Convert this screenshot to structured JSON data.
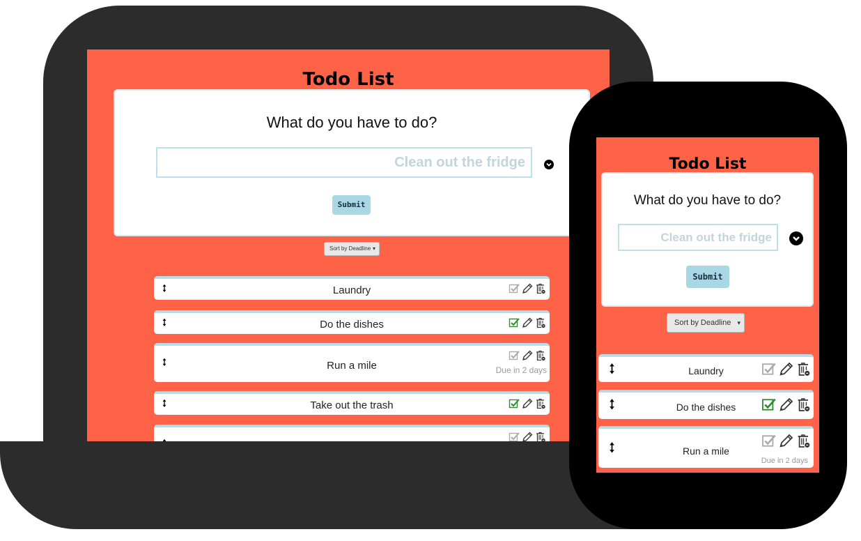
{
  "app": {
    "title": "Todo List",
    "question": "What do you have to do?",
    "input_placeholder": "Clean out the fridge",
    "submit_label": "Submit",
    "sort_label": "Sort by Deadline",
    "sort_arrow": "▾"
  },
  "todos": [
    {
      "label": "Laundry",
      "done": false,
      "due": ""
    },
    {
      "label": "Do the dishes",
      "done": true,
      "due": ""
    },
    {
      "label": "Run a mile",
      "done": false,
      "due": "Due in 2 days"
    },
    {
      "label": "Take out the trash",
      "done": true,
      "due": ""
    },
    {
      "label": "",
      "done": false,
      "due": ""
    }
  ],
  "colors": {
    "background": "#ff6347",
    "device": "#2c2c2c",
    "check_done": "#2e8b2e",
    "check_pending": "#aaaaaa",
    "accent": "#a8d8e6"
  },
  "icons": [
    "drag-handle-icon",
    "check-icon",
    "pencil-icon",
    "trash-icon",
    "chevron-down-icon"
  ]
}
